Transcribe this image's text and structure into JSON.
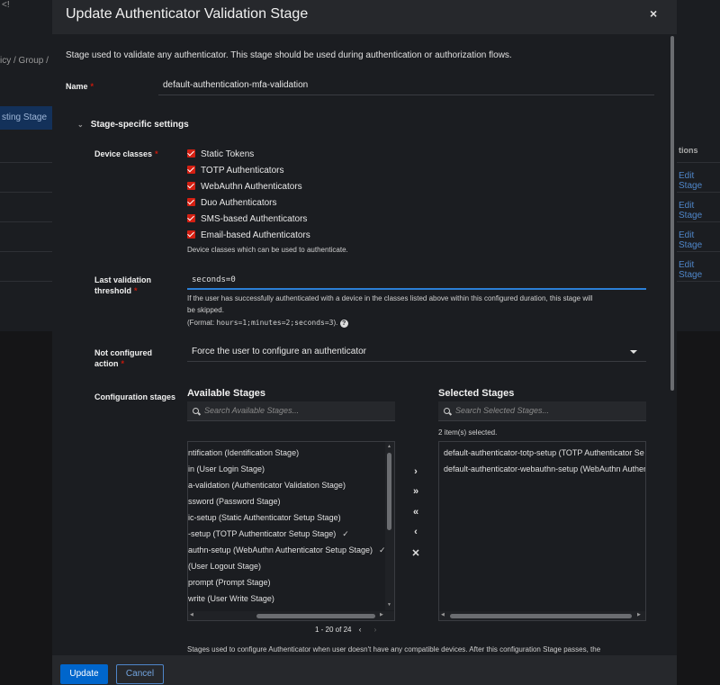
{
  "background": {
    "breadcrumb_fragment": "icy / Group /",
    "top_fragment": "<!",
    "selected_row": "sting Stage",
    "actions_header": "tions",
    "edit_links": [
      "Edit Stage",
      "Edit Stage",
      "Edit Stage",
      "Edit Stage"
    ]
  },
  "modal": {
    "title": "Update Authenticator Validation Stage",
    "close_glyph": "×",
    "description": "Stage used to validate any authenticator. This stage should be used during authentication or authorization flows.",
    "name_label": "Name",
    "name_value": "default-authentication-mfa-validation",
    "section_title": "Stage-specific settings",
    "device_classes_label": "Device classes",
    "device_classes": [
      "Static Tokens",
      "TOTP Authenticators",
      "WebAuthn Authenticators",
      "Duo Authenticators",
      "SMS-based Authenticators",
      "Email-based Authenticators"
    ],
    "device_classes_help": "Device classes which can be used to authenticate.",
    "last_validation_label_1": "Last validation",
    "last_validation_label_2": "threshold",
    "last_validation_value": "seconds=0",
    "last_validation_help_1": "If the user has successfully authenticated with a device in the classes listed above within this configured duration, this stage will",
    "last_validation_help_2": "be skipped.",
    "format_prefix": "(Format: ",
    "format_code": "hours=1;minutes=2;seconds=3",
    "format_suffix": ").",
    "not_configured_label_1": "Not configured",
    "not_configured_label_2": "action",
    "not_configured_value": "Force the user to configure an authenticator",
    "config_stages_label": "Configuration stages",
    "available_title": "Available Stages",
    "available_search_placeholder": "Search Available Stages...",
    "available_items": [
      {
        "text": "ntification (Identification Stage)",
        "checked": false
      },
      {
        "text": "in (User Login Stage)",
        "checked": false
      },
      {
        "text": "a-validation (Authenticator Validation Stage)",
        "checked": false
      },
      {
        "text": "ssword (Password Stage)",
        "checked": false
      },
      {
        "text": "ic-setup (Static Authenticator Setup Stage)",
        "checked": false
      },
      {
        "text": "-setup (TOTP Authenticator Setup Stage)",
        "checked": true
      },
      {
        "text": "authn-setup (WebAuthn Authenticator Setup Stage)",
        "checked": true
      },
      {
        "text": "(User Logout Stage)",
        "checked": false
      },
      {
        "text": "prompt (Prompt Stage)",
        "checked": false
      },
      {
        "text": "write (User Write Stage)",
        "checked": false
      }
    ],
    "check_glyph": "✓",
    "selected_title": "Selected Stages",
    "selected_search_placeholder": "Search Selected Stages...",
    "selected_count": "2 item(s) selected.",
    "selected_items": [
      "default-authenticator-totp-setup (TOTP Authenticator Se",
      "default-authenticator-webauthn-setup (WebAuthn Authent"
    ],
    "controls": [
      "›",
      "»",
      "«",
      "‹",
      "✕"
    ],
    "pager_range": "1 - 20 of 24",
    "pager_prev": "‹",
    "pager_next": "›",
    "config_help": "Stages used to configure Authenticator when user doesn't have any compatible devices. After this configuration Stage passes, the",
    "update_button": "Update",
    "cancel_button": "Cancel"
  },
  "colors": {
    "primary": "#0066cc",
    "required": "#c9190b",
    "checkbox": "#d41f12",
    "focus": "#2b7fd6"
  }
}
